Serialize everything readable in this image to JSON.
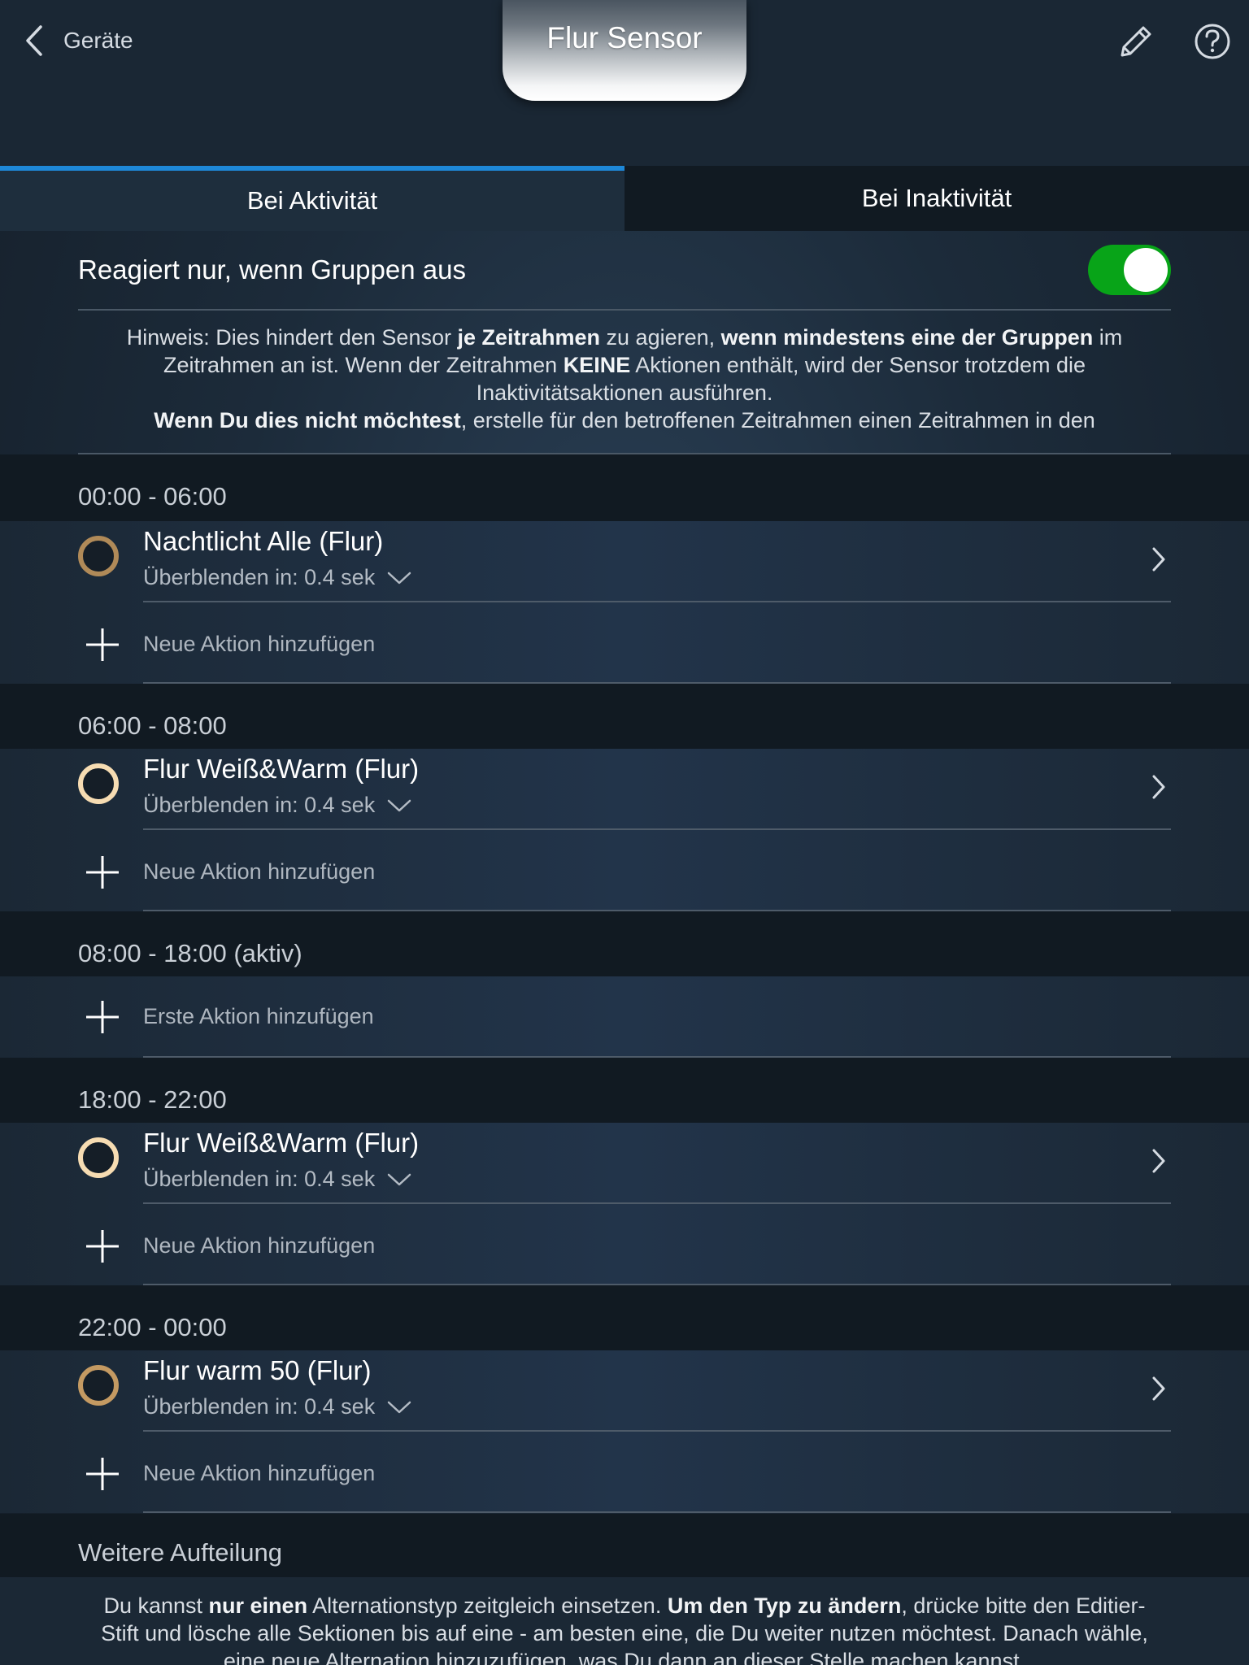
{
  "header": {
    "back_label": "Geräte",
    "title": "Flur Sensor",
    "edit_icon": "pencil-icon",
    "help_icon": "question-circle-icon"
  },
  "tabs": [
    {
      "label": "Bei Aktivität",
      "active": true
    },
    {
      "label": "Bei Inaktivität",
      "active": false
    }
  ],
  "toggle": {
    "label": "Reagiert nur, wenn Gruppen aus",
    "on": true,
    "color": "#08a418"
  },
  "hint": {
    "line1": [
      "Hinweis: Dies hindert den Sensor ",
      "je Zeitrahmen",
      " zu agieren, ",
      "wenn mindestens eine der Gruppen",
      " im"
    ],
    "line2": [
      "Zeitrahmen an ist. Wenn der Zeitrahmen ",
      "KEINE",
      " Aktionen enthält, wird der Sensor trotzdem die"
    ],
    "line3": "Inaktivitätsaktionen ausführen.",
    "line4": [
      "Wenn Du dies nicht möchtest",
      ", erstelle für den betroffenen Zeitrahmen einen Zeitrahmen in den"
    ]
  },
  "sections": [
    {
      "title": "00:00 - 06:00",
      "action": {
        "name": "Nachtlicht Alle (Flur)",
        "fade": "Überblenden in: 0.4 sek",
        "ring_color": "#b08a58"
      },
      "add_label": "Neue Aktion hinzufügen"
    },
    {
      "title": "06:00 - 08:00",
      "action": {
        "name": "Flur Weiß&Warm (Flur)",
        "fade": "Überblenden in: 0.4 sek",
        "ring_color": "#f6dcb2"
      },
      "add_label": "Neue Aktion hinzufügen"
    },
    {
      "title": "08:00 - 18:00 (aktiv)",
      "add_label": "Erste Aktion hinzufügen"
    },
    {
      "title": "18:00 - 22:00",
      "action": {
        "name": "Flur Weiß&Warm (Flur)",
        "fade": "Überblenden in: 0.4 sek",
        "ring_color": "#f6dcb2"
      },
      "add_label": "Neue Aktion hinzufügen"
    },
    {
      "title": "22:00 - 00:00",
      "action": {
        "name": "Flur warm 50 (Flur)",
        "fade": "Überblenden in: 0.4 sek",
        "ring_color": "#c49a62"
      },
      "add_label": "Neue Aktion hinzufügen"
    }
  ],
  "further": {
    "title": "Weitere Aufteilung",
    "line1": [
      "Du kannst ",
      "nur einen",
      " Alternationstyp zeitgleich einsetzen. ",
      "Um den Typ zu ändern",
      ", drücke bitte den Editier-"
    ],
    "line2": "Stift und lösche alle Sektionen bis auf eine - am besten eine, die Du weiter nutzen möchtest. Danach wähle,",
    "line3": "eine neue Alternation hinzuzufügen, was Du dann an dieser Stelle machen kannst."
  },
  "colors": {
    "accent": "#1e88d8",
    "toggle_on": "#08a418"
  }
}
